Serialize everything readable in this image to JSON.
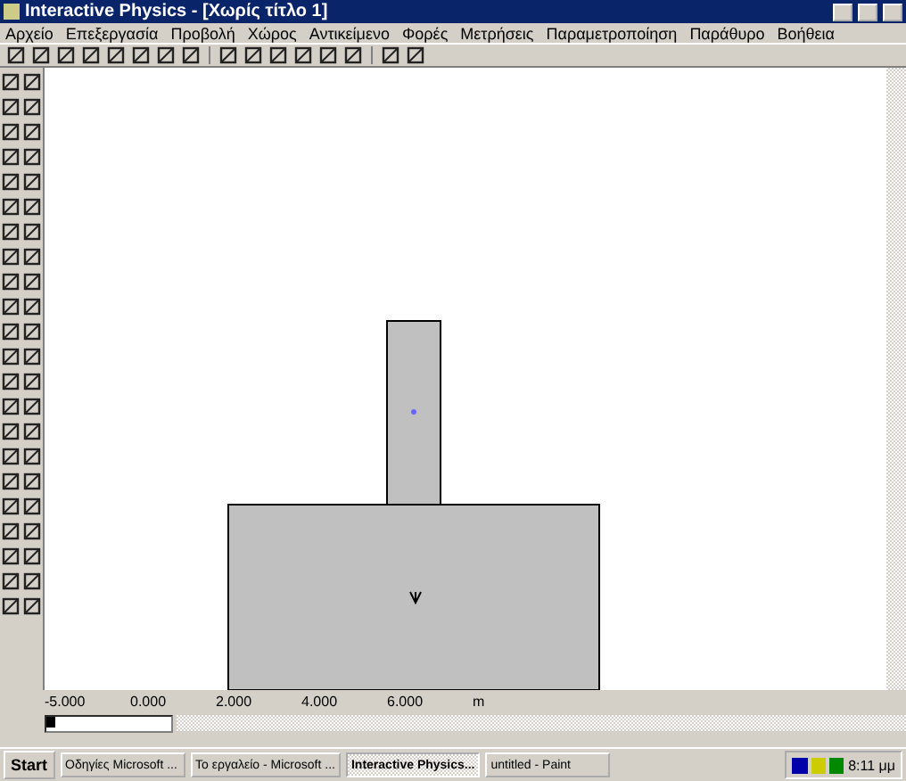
{
  "window": {
    "title": "Interactive Physics - [Χωρίς τίτλο 1]"
  },
  "menu": [
    "Αρχείο",
    "Επεξεργασία",
    "Προβολή",
    "Χώρος",
    "Αντικείμενο",
    "Φορές",
    "Μετρήσεις",
    "Παραμετροποίηση",
    "Παράθυρο",
    "Βοήθεια"
  ],
  "frame_slider": {
    "level": 0
  },
  "ruler": [
    "-5.000",
    "0.000",
    "2.000",
    "4.000",
    "6.000",
    "m"
  ],
  "taskbar": {
    "start": "Start",
    "tasks": [
      {
        "label": "Οδηγίες Microsoft ...",
        "selected": false
      },
      {
        "label": "Το εργαλείο - Microsoft ...",
        "selected": false
      },
      {
        "label": "Interactive Physics...",
        "selected": true
      },
      {
        "label": "untitled - Paint",
        "selected": false
      }
    ],
    "clock": "8:11 μμ"
  }
}
